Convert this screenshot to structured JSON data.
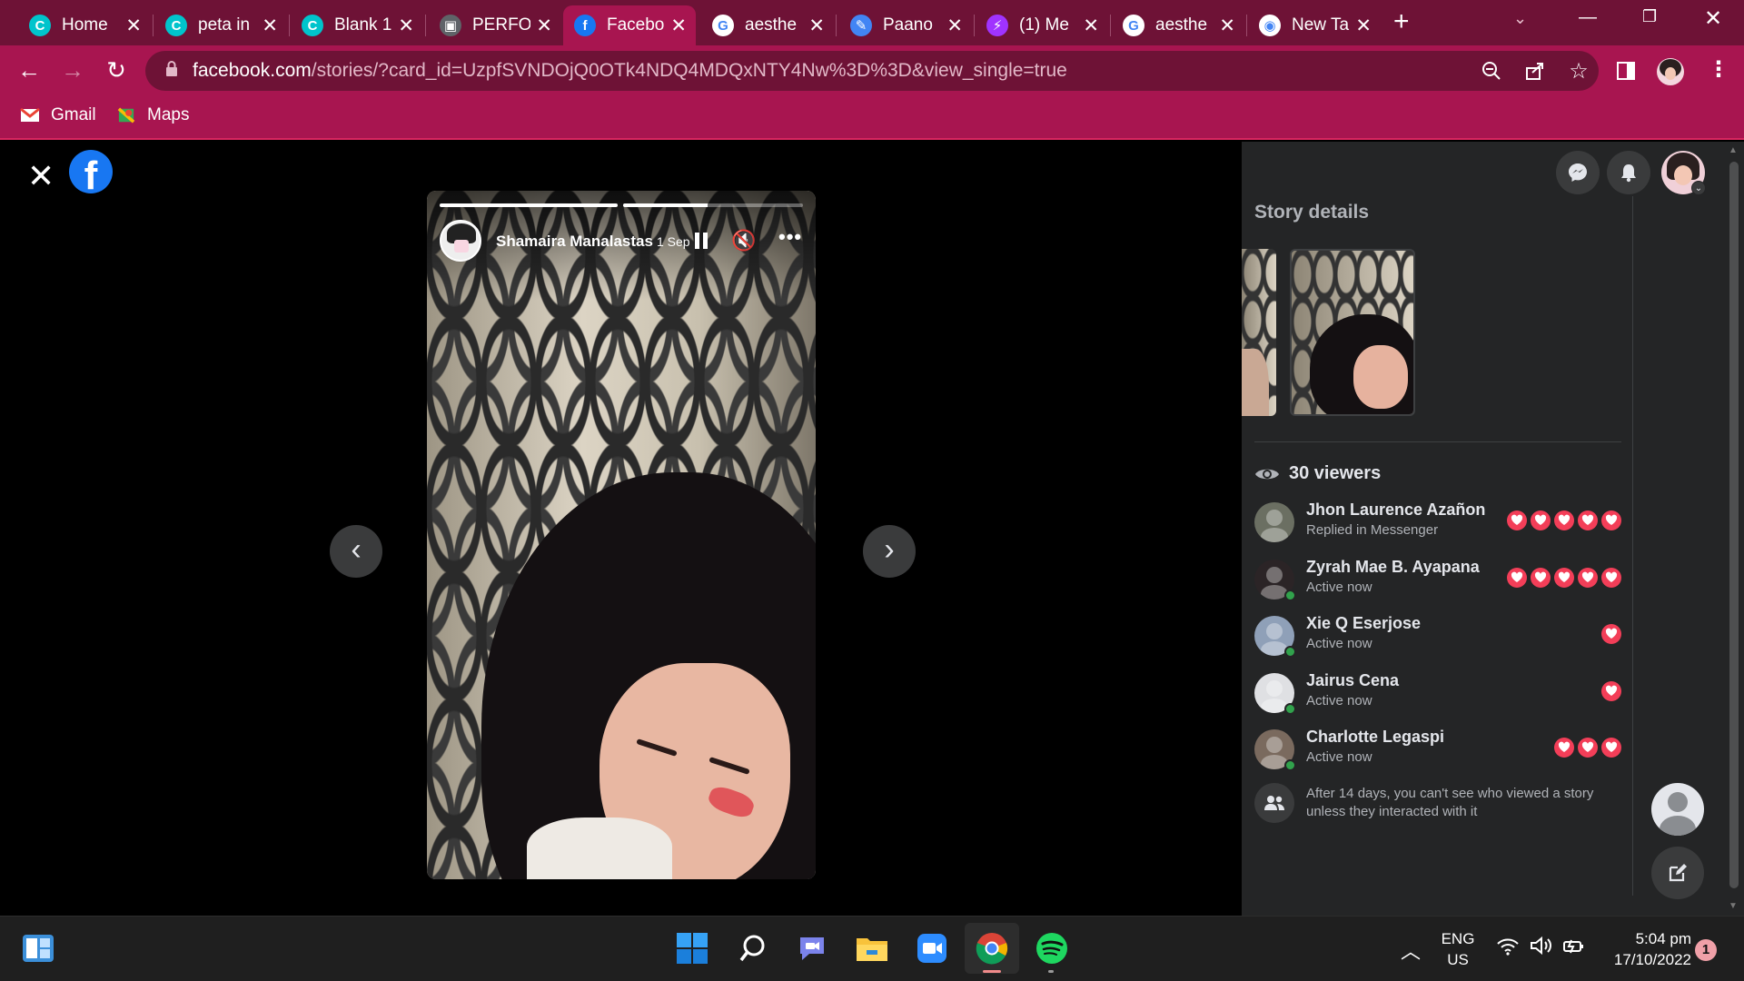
{
  "browser": {
    "tabs": [
      {
        "title": "Home",
        "favicon": "canva-icon",
        "color": "#00c4cc",
        "letter": "C"
      },
      {
        "title": "peta in",
        "favicon": "canva-icon",
        "color": "#00c4cc",
        "letter": "C"
      },
      {
        "title": "Blank 1",
        "favicon": "canva-icon",
        "color": "#00c4cc",
        "letter": "C"
      },
      {
        "title": "PERFO",
        "favicon": "classroom-icon",
        "color": "#5f6368",
        "letter": "▣"
      },
      {
        "title": "Facebo",
        "favicon": "facebook-icon",
        "color": "#1877f2",
        "letter": "f"
      },
      {
        "title": "aesthe",
        "favicon": "google-icon",
        "color": "#ffffff",
        "letter": "G"
      },
      {
        "title": "Paano",
        "favicon": "docs-icon",
        "color": "#4285f4",
        "letter": "✎"
      },
      {
        "title": "(1) Me",
        "favicon": "messenger-icon",
        "color": "#a033ff",
        "letter": "⚡"
      },
      {
        "title": "aesthe",
        "favicon": "google-icon",
        "color": "#ffffff",
        "letter": "G"
      },
      {
        "title": "New Ta",
        "favicon": "chrome-icon",
        "color": "#ffffff",
        "letter": "◉"
      }
    ],
    "active_tab_index": 4,
    "url_host": "facebook.com",
    "url_path": "/stories/?card_id=UzpfSVNDOjQ0OTk4NDQ4MDQxNTY4Nw%3D%3D&view_single=true",
    "bookmarks": [
      {
        "label": "Gmail"
      },
      {
        "label": "Maps"
      }
    ]
  },
  "story": {
    "author": "Shamaira Manalastas",
    "time": "1 Sep",
    "segments": [
      1.0,
      0.47
    ]
  },
  "panel": {
    "title": "Story details",
    "viewers_label": "30 viewers",
    "viewers": [
      {
        "name": "Jhon Laurence Azañon",
        "status": "Replied in Messenger",
        "hearts": 5,
        "online": false,
        "avatar_color": "#6b6f62"
      },
      {
        "name": "Zyrah Mae B. Ayapana",
        "status": "Active now",
        "hearts": 5,
        "online": true,
        "avatar_color": "#2b2426"
      },
      {
        "name": "Xie Q Eserjose",
        "status": "Active now",
        "hearts": 1,
        "online": true,
        "avatar_color": "#8fa0b8"
      },
      {
        "name": "Jairus Cena",
        "status": "Active now",
        "hearts": 1,
        "online": true,
        "avatar_color": "#dfe0e3"
      },
      {
        "name": "Charlotte Legaspi",
        "status": "Active now",
        "hearts": 3,
        "online": true,
        "avatar_color": "#7a6a5e"
      }
    ],
    "note": "After 14 days, you can't see who viewed a story unless they interacted with it"
  },
  "taskbar": {
    "lang_top": "ENG",
    "lang_bottom": "US",
    "time": "5:04 pm",
    "date": "17/10/2022",
    "notification_count": "1"
  },
  "colors": {
    "chrome_frame": "#6e1236",
    "chrome_toolbar": "#a81550",
    "facebook_blue": "#1877f2",
    "heart_red": "#f33e58",
    "online_green": "#31a24c"
  }
}
